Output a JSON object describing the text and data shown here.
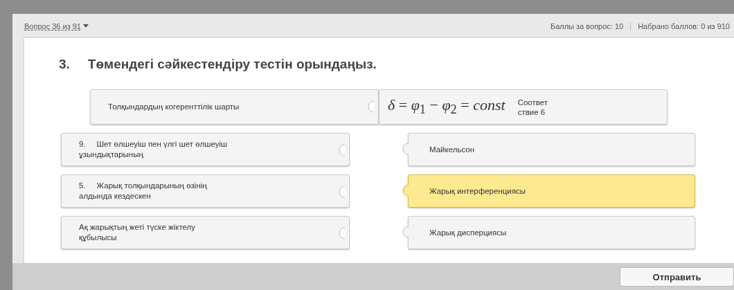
{
  "header": {
    "question_selector": "Вопрос 36 из 91",
    "points_per_question": "Баллы за вопрос: 10",
    "points_total": "Набрано баллов: 0 из 910"
  },
  "question": {
    "number": "3.",
    "text": "Төмендегі сәйкестендіру тестін орындаңыз."
  },
  "matched": [
    {
      "left": "Толқындардың когеренттілік шарты",
      "formula": "*δ* = *φ*$_{1}$ − *φ*$_{2}$ = *const*",
      "label": "Соответствие 6"
    }
  ],
  "rows": [
    {
      "left": "9.     Шет өлшеуіш пен үлгі шет өлшеуіш ұзындықтарының",
      "right": "Майкельсон",
      "selected": false
    },
    {
      "left": "5.     Жарық толқындарының өзінің алдында кездескен",
      "right": "Жарық интерференциясы",
      "selected": true
    },
    {
      "left": "Ақ жарықтың жеті түске жіктелу құбылысы",
      "right": "Жарық дисперциясы",
      "selected": false
    }
  ],
  "submit": "Отправить"
}
